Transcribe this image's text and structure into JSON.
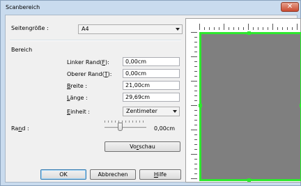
{
  "window": {
    "title": "Scanbereich",
    "close_glyph": "✕"
  },
  "page_size": {
    "label": "Seitengröße :",
    "value": "A4"
  },
  "area": {
    "heading": "Bereich",
    "left": {
      "label_pre": "Linker Rand(",
      "label_key": "F",
      "label_post": "):",
      "value": "0,00cm"
    },
    "top": {
      "label_pre": "Oberer Rand(",
      "label_key": "T",
      "label_post": "):",
      "value": "0,00cm"
    },
    "width": {
      "label_key": "B",
      "label_post": "reite :",
      "value": "21,00cm"
    },
    "height": {
      "label_key": "L",
      "label_post": "änge :",
      "value": "29,69cm"
    },
    "unit": {
      "label_key": "E",
      "label_post": "inheit :",
      "value": "Zentimeter"
    }
  },
  "margin": {
    "label_pre": "Ra",
    "label_key": "n",
    "label_post": "d :",
    "value": "0,00cm",
    "level": 0.35
  },
  "buttons": {
    "preview": {
      "pre": "Vo",
      "key": "r",
      "post": "schau"
    },
    "ok": "OK",
    "cancel": "Abbrechen",
    "help": {
      "key": "H",
      "post": "ilfe"
    }
  },
  "icons": {
    "close": "close-icon",
    "dropdown": "chevron-down-icon",
    "slider": "slider-thumb-icon"
  },
  "colors": {
    "selection": "#2ee82e",
    "page_fill": "#7f7f7f",
    "titlebar": "#c9dbee"
  }
}
